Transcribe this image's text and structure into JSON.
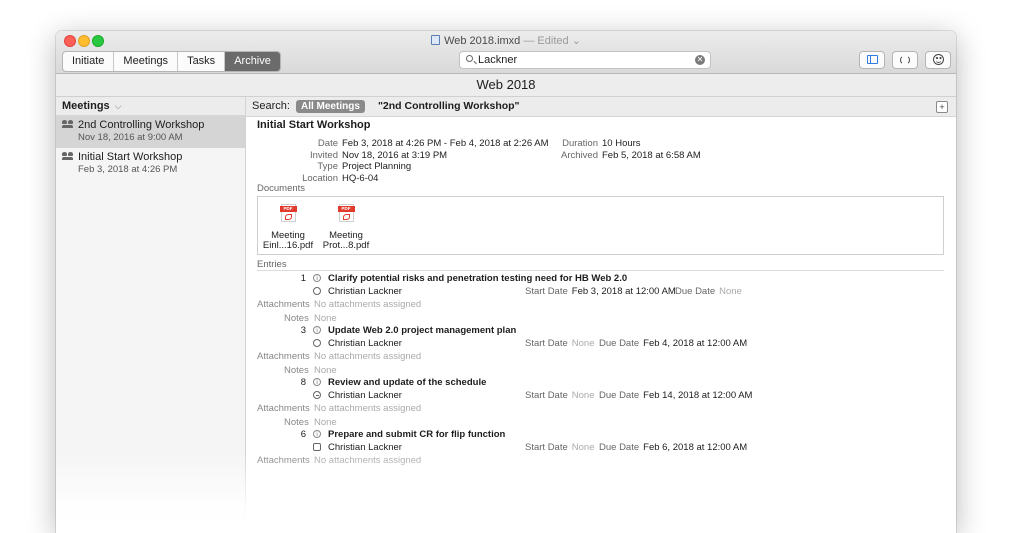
{
  "window": {
    "title": "Web 2018.imxd",
    "edited": " — Edited",
    "edited_chevron": "⌄"
  },
  "toolbar": {
    "segments": [
      "Initiate",
      "Meetings",
      "Tasks",
      "Archive"
    ],
    "active_segment": "Archive",
    "search_value": "Lackner",
    "clear_glyph": "✕"
  },
  "document_title": "Web 2018",
  "sidebar": {
    "header": "Meetings",
    "header_chevron": "⌵",
    "items": [
      {
        "title": "2nd Controlling Workshop",
        "date": "Nov 18, 2016 at 9:00 AM"
      },
      {
        "title": "Initial Start Workshop",
        "date": "Feb 3, 2018 at 4:26 PM"
      }
    ]
  },
  "searchbar": {
    "label": "Search:",
    "scope": "All Meetings",
    "query": "\"2nd Controlling Workshop\"",
    "add_glyph": "+"
  },
  "meeting": {
    "title": "Initial Start Workshop",
    "date_label": "Date",
    "date": "Feb 3, 2018 at 4:26 PM - Feb 4, 2018 at 2:26 AM",
    "invited_label": "Invited",
    "invited": "Nov 18, 2016 at 3:19 PM",
    "type_label": "Type",
    "type": "Project Planning",
    "location_label": "Location",
    "location": "HQ-6-04",
    "duration_label": "Duration",
    "duration": "10 Hours",
    "archived_label": "Archived",
    "archived": "Feb 5, 2018 at 6:58 AM",
    "documents_label": "Documents",
    "documents": [
      {
        "line1": "Meeting",
        "line2": "Einl...16.pdf",
        "badge": "PDF"
      },
      {
        "line1": "Meeting",
        "line2": "Prot...8.pdf",
        "badge": "PDF"
      }
    ],
    "entries_label": "Entries",
    "attachments_label": "Attachments",
    "notes_label": "Notes",
    "start_label": "Start Date",
    "due_label": "Due Date",
    "info_glyph": "i",
    "entries": [
      {
        "num": "1",
        "title": "Clarify potential risks and penetration testing need for HB Web 2.0",
        "person": "Christian Lackner",
        "start": "Feb 3, 2018 at 12:00 AM",
        "due": "None",
        "attachments": "No attachments assigned",
        "notes": "None"
      },
      {
        "num": "3",
        "title": "Update Web 2.0 project management plan",
        "person": "Christian Lackner",
        "start": "None",
        "due": "Feb 4, 2018 at 12:00 AM",
        "attachments": "No attachments assigned",
        "notes": "None"
      },
      {
        "num": "8",
        "title": "Review and update of the schedule",
        "person": "Christian Lackner",
        "start": "None",
        "due": "Feb 14, 2018 at 12:00 AM",
        "attachments": "No attachments assigned",
        "notes": "None"
      },
      {
        "num": "6",
        "title": "Prepare and submit CR for flip function",
        "person": "Christian Lackner",
        "start": "None",
        "due": "Feb 6, 2018 at 12:00 AM",
        "attachments": "No attachments assigned",
        "notes": ""
      }
    ]
  },
  "colors": {
    "active_segment": "#6b6b6b",
    "selection": "#d5d5d5",
    "pdf_red": "#e23b2e",
    "accent": "#2f7ae5"
  }
}
